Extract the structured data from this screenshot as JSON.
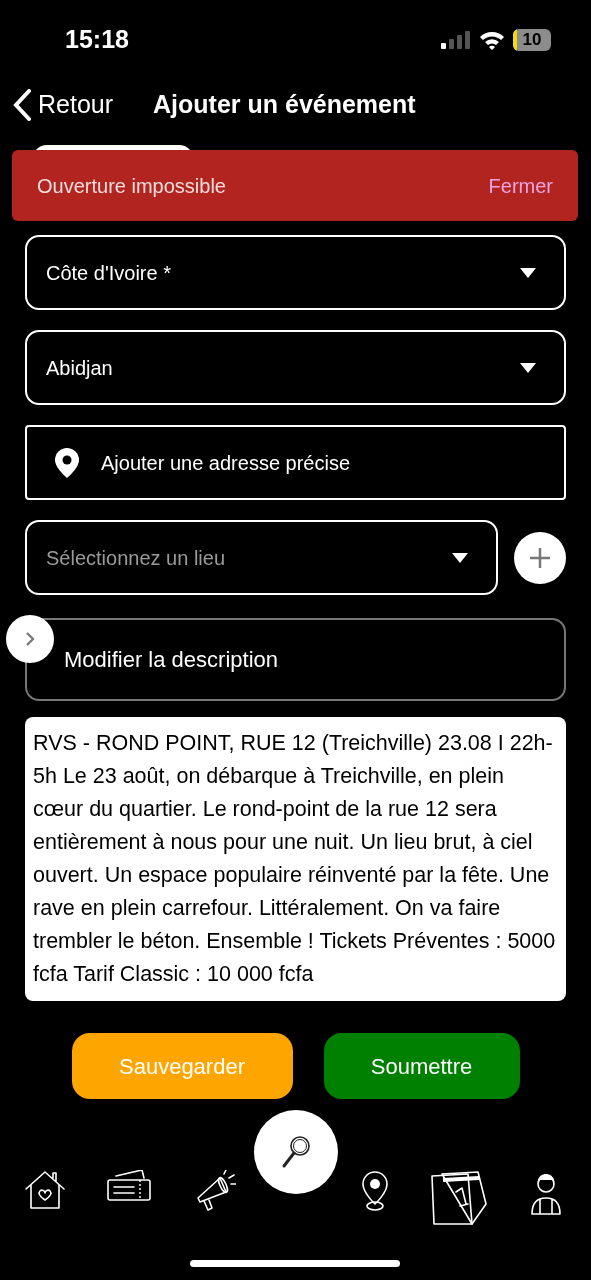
{
  "status_bar": {
    "time": "15:18",
    "battery": "10"
  },
  "nav": {
    "back": "Retour",
    "title": "Ajouter un événement"
  },
  "toast": {
    "message": "Ouverture impossible",
    "action": "Fermer"
  },
  "fields": [
    {
      "kind": "select",
      "value": "Côte d'Ivoire *"
    },
    {
      "kind": "select",
      "value": "Abidjan"
    },
    {
      "kind": "address",
      "label": "Ajouter une adresse précise"
    },
    {
      "kind": "select",
      "placeholder": "Sélectionnez un lieu",
      "add_button": true
    }
  ],
  "description_button": "Modifier la description",
  "description": "RVS - ROND POINT, RUE 12 (Treichville) 23.08 I 22h-5h Le 23 août, on débarque à Treichville, en plein cœur du quartier. Le rond-point de la rue 12 sera entièrement à nous pour une nuit. Un lieu brut, à ciel ouvert. Un espace populaire réinventé par la fête. Une rave en plein carrefour. Littéralement. On va faire trembler le béton. Ensemble ! Tickets Préventes : 5000 fcfa Tarif Classic : 10 000 fcfa",
  "actions": [
    {
      "label": "Sauvegarder",
      "color": "#ffa500"
    },
    {
      "label": "Soumettre",
      "color": "#008000"
    }
  ]
}
